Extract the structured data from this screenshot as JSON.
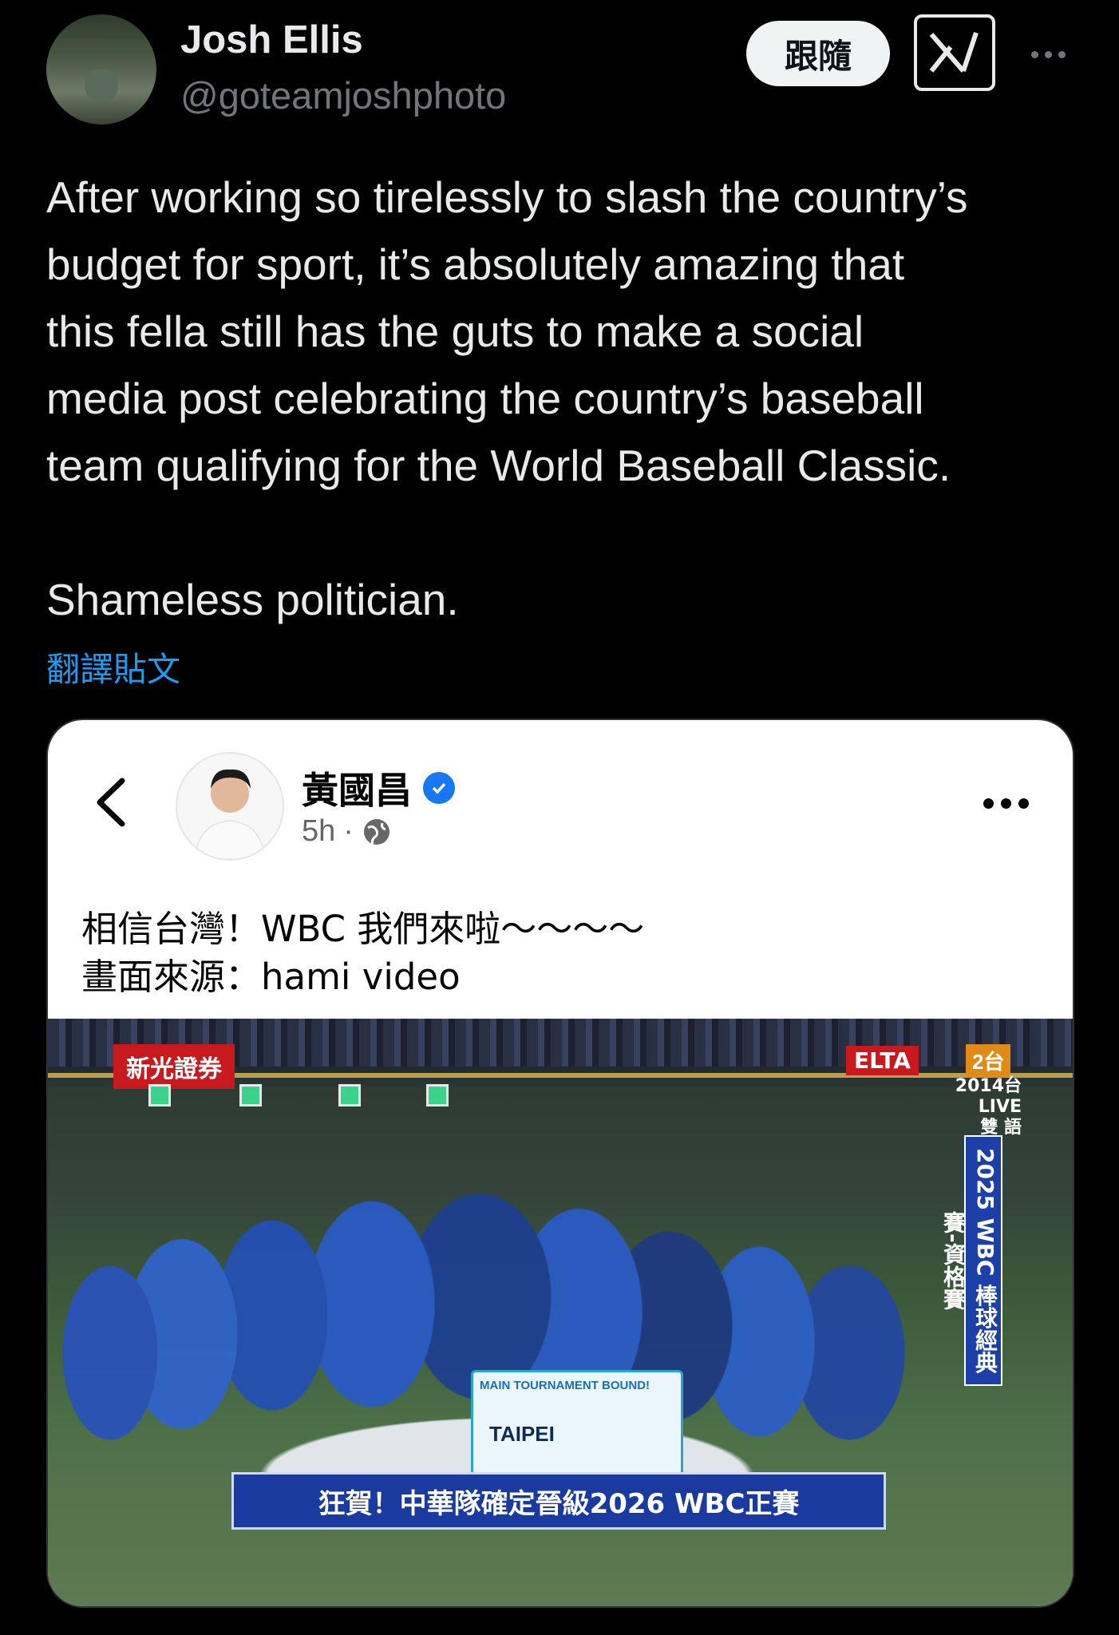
{
  "author": {
    "name": "Josh Ellis",
    "handle": "@goteamjoshphoto"
  },
  "header": {
    "follow_label": "跟隨"
  },
  "tweet": {
    "text": "After working so tirelessly to slash the country’s\nbudget for sport, it’s absolutely amazing that\nthis fella still has the guts to make a social\nmedia post celebrating the country’s baseball\nteam qualifying for the World Baseball Classic.\n\nShameless politician.",
    "translate_label": "翻譯貼文"
  },
  "embedded_post": {
    "name": "黃國昌",
    "time": "5h",
    "text": "相信台灣！WBC 我們來啦～～～～\n畫面來源：hami video",
    "photo": {
      "sponsor": "新光證券",
      "broadcaster": "ELTA",
      "channel": "2台",
      "live_label": "2014台 LIVE\n雙 語",
      "side_banner": "2025 WBC 棒球經典賽-資格賽",
      "team_banner_top": "MAIN TOURNAMENT BOUND!",
      "team_banner_main": "TAIPEI",
      "caption": "狂賀！中華隊確定晉級2026 WBC正賽"
    }
  },
  "colors": {
    "background": "#000000",
    "text": "#e7e9ea",
    "secondary": "#71767b",
    "link": "#1d9bf0",
    "verified": "#1877f2"
  }
}
